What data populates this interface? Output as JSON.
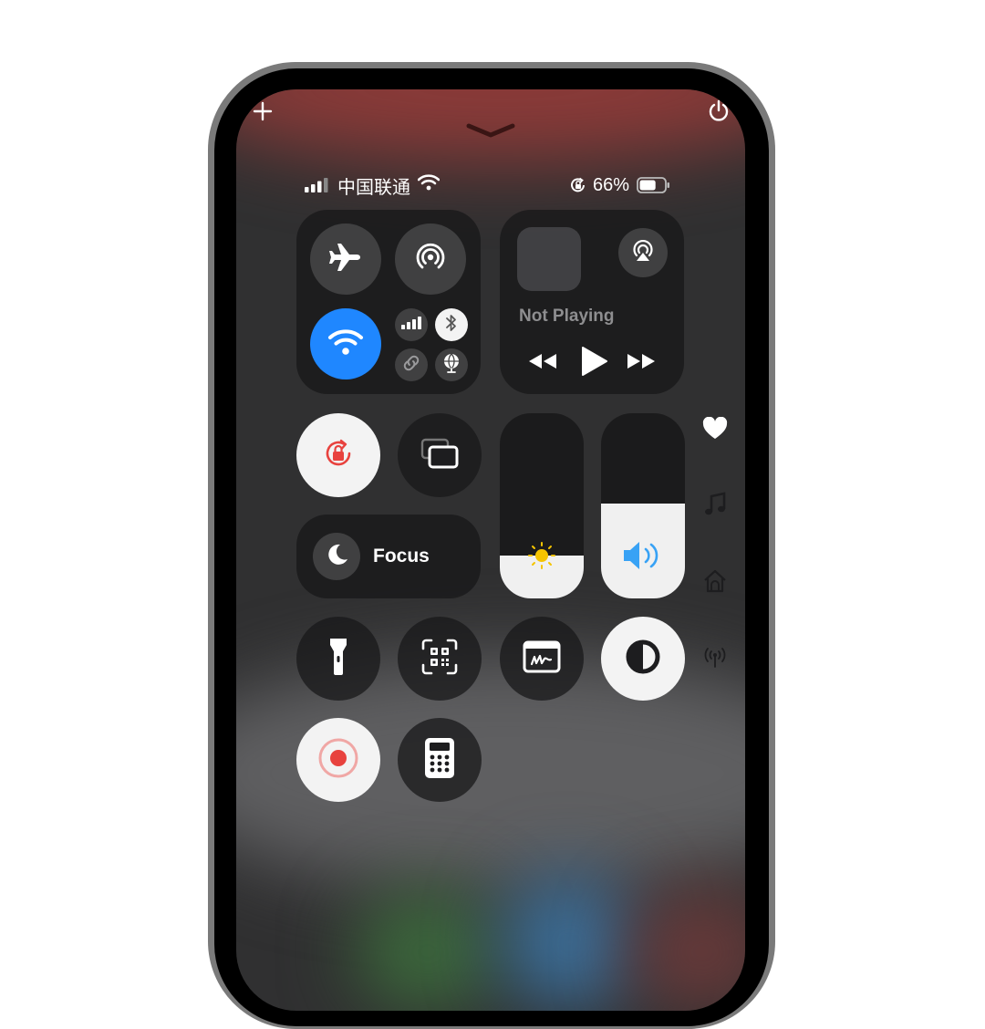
{
  "status_bar": {
    "carrier": "中国联通",
    "battery_percent": "66%",
    "battery_level": 0.66
  },
  "top_controls": {
    "add_icon": "plus-icon",
    "power_icon": "power-icon",
    "dismiss_icon": "chevron-down-icon"
  },
  "connectivity": {
    "airplane_mode": false,
    "airdrop": false,
    "wifi": true,
    "cellular": false,
    "bluetooth": true,
    "personal_hotspot": false,
    "vpn": true
  },
  "now_playing": {
    "status": "Not Playing"
  },
  "focus": {
    "label": "Focus"
  },
  "sliders": {
    "brightness_level": 0.23,
    "volume_level": 0.51
  },
  "colors": {
    "wifi_active": "#1f87ff",
    "lock_red": "#e8423e",
    "volume_blue": "#38a2f5",
    "sun_yellow": "#f5c400"
  },
  "side_icons": [
    "heart-icon",
    "music-note-icon",
    "home-icon",
    "antenna-icon"
  ]
}
